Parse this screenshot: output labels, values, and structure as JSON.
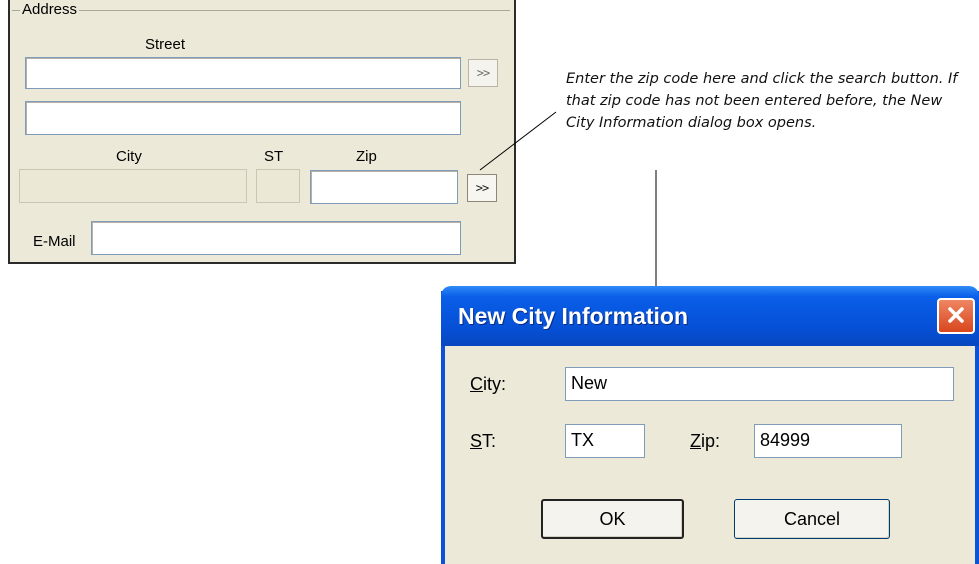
{
  "address_panel": {
    "legend": "Address",
    "street_label": "Street",
    "city_label": "City",
    "st_label": "ST",
    "zip_label": "Zip",
    "email_label": "E-Mail",
    "street_lookup_button": ">>",
    "zip_search_button": ">>"
  },
  "annotation": {
    "text": "Enter the zip code here and click the search button. If that zip code has not been entered before, the New City Information dialog box opens."
  },
  "dialog": {
    "title": "New City Information",
    "city_label_mnemonic": "C",
    "city_label_rest": "ity:",
    "city_value": "New",
    "st_label_mnemonic": "S",
    "st_label_rest": "T:",
    "st_value": "TX",
    "zip_label_mnemonic": "Z",
    "zip_label_rest": "ip:",
    "zip_value": "84999",
    "ok_label": "OK",
    "cancel_label": "Cancel",
    "title_bar_color": "#0650d6",
    "close_button_color": "#d9461d"
  }
}
